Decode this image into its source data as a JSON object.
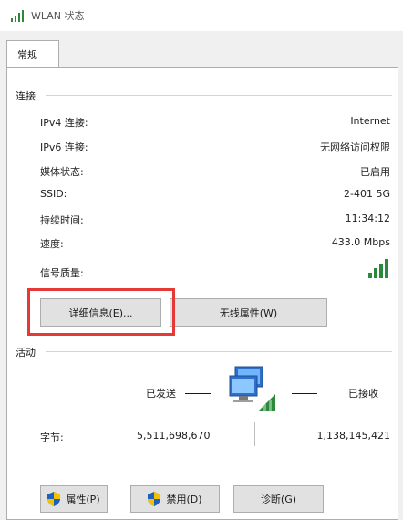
{
  "window": {
    "title": "WLAN 状态",
    "icon": "wifi-signal-icon"
  },
  "tabs": [
    {
      "label": "常规"
    }
  ],
  "connection": {
    "title": "连接",
    "rows": [
      {
        "label": "IPv4 连接:",
        "value": "Internet"
      },
      {
        "label": "IPv6 连接:",
        "value": "无网络访问权限"
      },
      {
        "label": "媒体状态:",
        "value": "已启用"
      },
      {
        "label": "SSID:",
        "value": "2-401 5G"
      },
      {
        "label": "持续时间:",
        "value": "11:34:12"
      },
      {
        "label": "速度:",
        "value": "433.0 Mbps"
      },
      {
        "label": "信号质量:",
        "value": ""
      }
    ],
    "signal_bars_filled": 5,
    "signal_bars_total": 5
  },
  "buttons": {
    "details": "详细信息(E)...",
    "wireless_props": "无线属性(W)"
  },
  "activity": {
    "title": "活动",
    "sent_label": "已发送",
    "received_label": "已接收",
    "bytes_label": "字节:",
    "bytes_sent": "5,511,698,670",
    "bytes_received": "1,138,145,421",
    "network_icon": "network-computers-icon"
  },
  "bottom_buttons": {
    "properties": "属性(P)",
    "disable": "禁用(D)",
    "diagnose": "诊断(G)"
  },
  "colors": {
    "highlight": "#e53935",
    "signal": "#2a8a3a",
    "shield_blue": "#1f5fbf",
    "shield_yellow": "#f2c200"
  }
}
